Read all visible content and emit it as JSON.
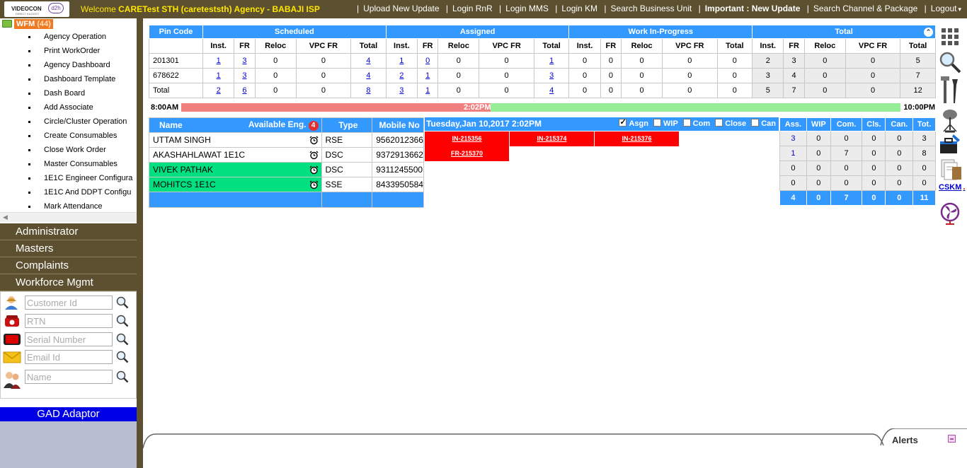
{
  "header": {
    "logo_brand": "VIDEOCON",
    "logo_sub": "d2h",
    "logo_tagline": "DIRECT KA DOST",
    "welcome_prefix": "Welcome",
    "welcome_text": " CARETest STH (careteststh) Agency - BABAJI ISP",
    "links": [
      "Upload New Update",
      "Login RnR",
      "Login MMS",
      "Login KM",
      "Search Business Unit",
      "Important : New Update",
      "Search Channel & Package",
      "Logout"
    ],
    "logout_arrow": "▾"
  },
  "leftmenu": {
    "root_label": "WFM",
    "root_count": "(44)",
    "items": [
      "Agency Operation",
      "Print WorkOrder",
      "Agency Dashboard",
      "Dashboard Template",
      "Dash Board",
      "Add Associate",
      "Circle/Cluster Operation",
      "Create Consumables",
      "Close Work Order",
      "Master Consumables",
      "1E1C Engineer Configura",
      "1E1C And DDPT Configu",
      "Mark Attendance"
    ],
    "accordion": [
      "Administrator",
      "Masters",
      "Complaints",
      "Workforce Mgmt"
    ],
    "search": {
      "customer_id": "Customer Id",
      "rtn": "RTN",
      "serial_number": "Serial Number",
      "email_id": "Email Id",
      "name": "Name"
    },
    "gad_label": "GAD Adaptor"
  },
  "schedule": {
    "group_headers": [
      "Pin Code",
      "Scheduled",
      "Assigned",
      "Work In-Progress",
      "Total"
    ],
    "sub_headers": [
      "Inst.",
      "FR",
      "Reloc",
      "VPC FR",
      "Total"
    ],
    "rows": [
      {
        "pin": "201301",
        "vals": [
          "1",
          "3",
          "0",
          "0",
          "4",
          "1",
          "0",
          "0",
          "0",
          "1",
          "0",
          "0",
          "0",
          "0",
          "0",
          "2",
          "3",
          "0",
          "0",
          "5"
        ]
      },
      {
        "pin": "678622",
        "vals": [
          "1",
          "3",
          "0",
          "0",
          "4",
          "2",
          "1",
          "0",
          "0",
          "3",
          "0",
          "0",
          "0",
          "0",
          "0",
          "3",
          "4",
          "0",
          "0",
          "7"
        ]
      },
      {
        "pin": "Total",
        "vals": [
          "2",
          "6",
          "0",
          "0",
          "8",
          "3",
          "1",
          "0",
          "0",
          "4",
          "0",
          "0",
          "0",
          "0",
          "0",
          "5",
          "7",
          "0",
          "0",
          "12"
        ]
      }
    ],
    "collapse_icon": "⌃"
  },
  "timeline": {
    "start": "8:00AM",
    "current": "2:02PM",
    "end": "10:00PM",
    "elapsed_fraction": 0.43
  },
  "engineers": {
    "headers": {
      "name": "Name",
      "available": "Available Eng.",
      "available_count": "4",
      "type": "Type",
      "mobile": "Mobile No"
    },
    "rows": [
      {
        "name": "UTTAM SINGH",
        "type": "RSE",
        "mobile": "9562012366"
      },
      {
        "name": "AKASHAHLAWAT 1E1C",
        "type": "DSC",
        "mobile": "9372913662"
      },
      {
        "name": "VIVEK PATHAK",
        "type": "DSC",
        "mobile": "9311245500"
      },
      {
        "name": "MOHITCS 1E1C",
        "type": "SSE",
        "mobile": "8433950584"
      }
    ]
  },
  "slots": {
    "date": "Tuesday,Jan 10,2017 2:02PM",
    "filters": [
      "Asgn",
      "WIP",
      "Com",
      "Close",
      "Can"
    ],
    "jobs_row1": [
      "IN-215356",
      "IN-215374",
      "IN-215376"
    ],
    "jobs_row2": [
      "FR-215370"
    ]
  },
  "counts": {
    "headers": [
      "Ass.",
      "WIP",
      "Com.",
      "Cls.",
      "Can.",
      "Tot."
    ],
    "rows": [
      [
        "3",
        "0",
        "0",
        "0",
        "0",
        "3"
      ],
      [
        "1",
        "0",
        "7",
        "0",
        "0",
        "8"
      ],
      [
        "0",
        "0",
        "0",
        "0",
        "0",
        "0"
      ],
      [
        "0",
        "0",
        "0",
        "0",
        "0",
        "0"
      ]
    ],
    "total": [
      "4",
      "0",
      "7",
      "0",
      "0",
      "11"
    ]
  },
  "right_icons": [
    "apps-grid-icon",
    "search-icon",
    "tools-icon",
    "satellite-dish-icon",
    "toolbox-icon",
    "documents-icon",
    "fan-icon"
  ],
  "cskm_label": "CSKM",
  "cskm_dot": ".",
  "alerts_label": "Alerts",
  "colors": {
    "header_bg": "#5c5030",
    "blue": "#3399ff",
    "job_red": "#ff0000",
    "available_green": "#00e080"
  }
}
